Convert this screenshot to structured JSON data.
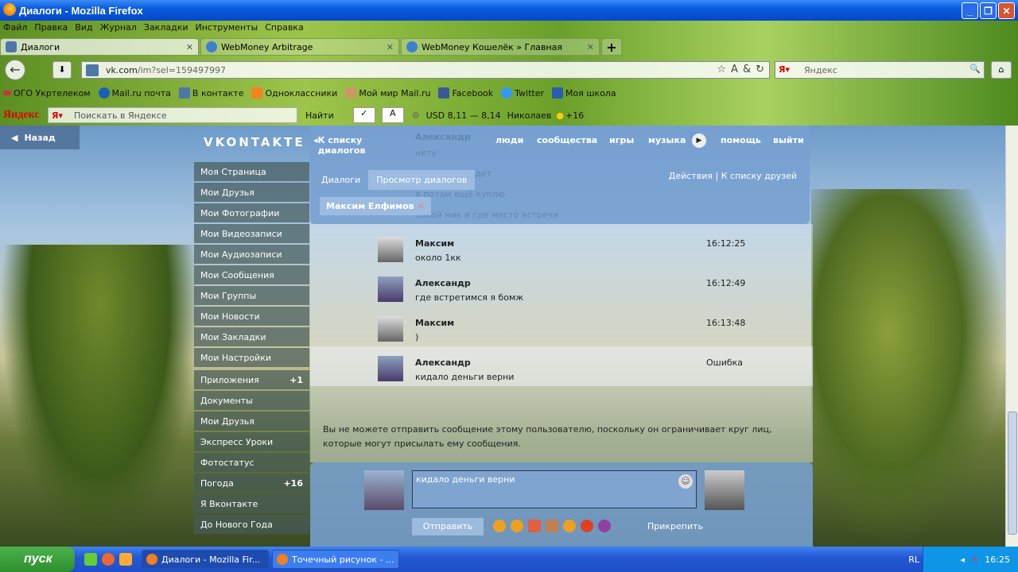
{
  "window": {
    "title": "Диалоги - Mozilla Firefox"
  },
  "menu": [
    "Файл",
    "Правка",
    "Вид",
    "Журнал",
    "Закладки",
    "Инструменты",
    "Справка"
  ],
  "tabs": [
    {
      "label": "Диалоги"
    },
    {
      "label": "WebMoney Arbitrage"
    },
    {
      "label": "WebMoney Кошелёк » Главная"
    }
  ],
  "url": {
    "host": "vk.com",
    "path": "/im?sel=159497997"
  },
  "search": {
    "placeholder": "Яндекс"
  },
  "bookmarks": [
    "ОГО Укртелеком",
    "Mail.ru почта",
    "В контакте",
    "Одноклассники",
    "Мой мир Mail.ru",
    "Facebook",
    "Twitter",
    "Моя школа"
  ],
  "yandex_bar": {
    "logo": "Яндекс",
    "placeholder": "Поискать в Яндексе",
    "find": "Найти",
    "currency": "USD 8,11 — 8,14",
    "city": "Николаев",
    "weather": "+16"
  },
  "vk": {
    "back": "Назад",
    "logo": "VKONTAKTE",
    "sidebar": [
      {
        "label": "Моя Страница"
      },
      {
        "label": "Мои Друзья"
      },
      {
        "label": "Мои Фотографии"
      },
      {
        "label": "Мои Видеозаписи"
      },
      {
        "label": "Мои Аудиозаписи"
      },
      {
        "label": "Мои Сообщения"
      },
      {
        "label": "Мои Группы"
      },
      {
        "label": "Мои Новости"
      },
      {
        "label": "Мои Закладки"
      },
      {
        "label": "Мои Настройки"
      },
      {
        "label": "Приложения",
        "count": "+1"
      },
      {
        "label": "Документы"
      },
      {
        "label": "Мои Друзья"
      },
      {
        "label": "Экспресс Уроки"
      },
      {
        "label": "Фотостатус"
      },
      {
        "label": "Погода",
        "count": "+16"
      },
      {
        "label": "Я Вконтакте"
      },
      {
        "label": "До Нового Года"
      }
    ],
    "top": {
      "back_to_dialogs": "К списку диалогов",
      "people": "люди",
      "communities": "сообщества",
      "games": "игры",
      "music": "музыка",
      "help": "помощь",
      "logout": "выйти"
    },
    "subtabs": {
      "dialogs": "Диалоги",
      "view": "Просмотр диалогов",
      "actions": "Действия",
      "sep": "|",
      "friends": "К списку друзей"
    },
    "chip": "Максим Елфимов",
    "ghost": {
      "name": "Александр",
      "t1": "нету",
      "t2": "будет",
      "t3": "я потом ещё куплю",
      "t4": "какой ник и где место встречи"
    },
    "messages": [
      {
        "name": "Максим",
        "text": "около 1кк",
        "time": "16:12:25",
        "avatar": "m"
      },
      {
        "name": "Александр",
        "text": "где встретимся я бомж",
        "time": "16:12:49",
        "avatar": "a"
      },
      {
        "name": "Максим",
        "text": ")",
        "time": "16:13:48",
        "avatar": "m"
      },
      {
        "name": "Александр",
        "text": "кидало деньги верни",
        "time": "Ошибка",
        "avatar": "a"
      }
    ],
    "notice": "Вы не можете отправить сообщение этому пользователю, поскольку он ограничивает круг лиц, которые могут присылать ему сообщения.",
    "compose": {
      "text": "кидало деньги верни",
      "send": "Отправить",
      "attach": "Прикрепить"
    }
  },
  "taskbar": {
    "start": "пуск",
    "tasks": [
      "Диалоги - Mozilla Fir...",
      "Точечный рисунок - ..."
    ],
    "lang": "RL",
    "clock": "16:25"
  }
}
